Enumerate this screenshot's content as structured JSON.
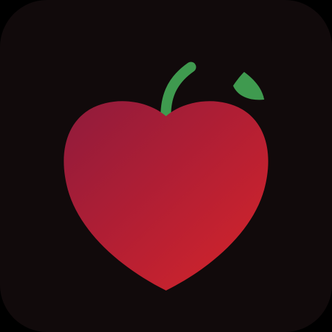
{
  "icon": {
    "symbol": "apple-icon",
    "parts": [
      "apple-body",
      "apple-stem",
      "apple-leaf"
    ]
  },
  "colors": {
    "background": "#110a0b",
    "apple_dark": "#8f1b3c",
    "apple_mid": "#b51f33",
    "apple_light": "#d6252a",
    "stem": "#3f9a4f",
    "leaf": "#3f9a4f"
  }
}
